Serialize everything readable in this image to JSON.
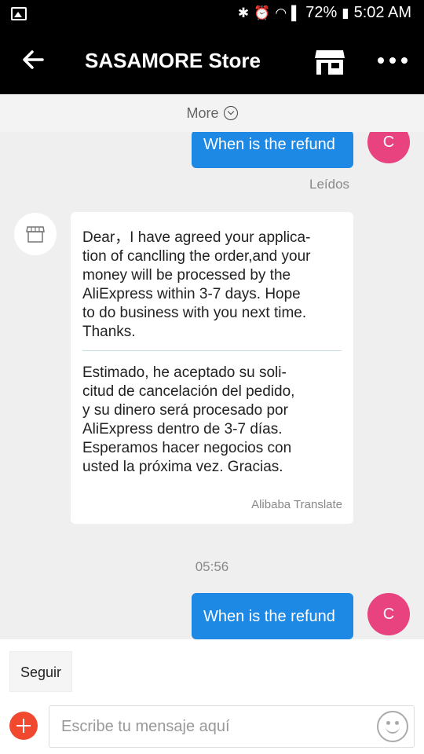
{
  "status_bar": {
    "battery": "72%",
    "time": "5:02 AM"
  },
  "header": {
    "title": "SASAMORE Store"
  },
  "chat": {
    "more_label": "More",
    "messages": [
      {
        "type": "outgoing",
        "text": "When is the refund",
        "avatar_initial": "C",
        "status": "Leídos"
      },
      {
        "type": "incoming",
        "original": "Dear，I have agreed your applica-\ntion of canclling the order,and your\nmoney will be processed by the\nAliExpress within 3-7 days. Hope\nto do business with you next time.\nThanks.",
        "translated": "Estimado, he aceptado su soli-\ncitud de cancelación del pedido,\ny su dinero será procesado por\nAliExpress dentro de 3-7 días.\nEsperamos hacer negocios con\nusted la próxima vez. Gracias.",
        "translation_provider": "Alibaba Translate"
      },
      {
        "type": "timestamp",
        "text": "05:56"
      },
      {
        "type": "outgoing",
        "text": "When is the refund",
        "avatar_initial": "C"
      }
    ]
  },
  "bottom_bar": {
    "follow_label": "Seguir",
    "input_placeholder": "Escribe tu mensaje aquí"
  },
  "colors": {
    "accent_blue": "#1e88e5",
    "avatar_pink": "#e8427f",
    "add_button_red": "#f0492f"
  }
}
